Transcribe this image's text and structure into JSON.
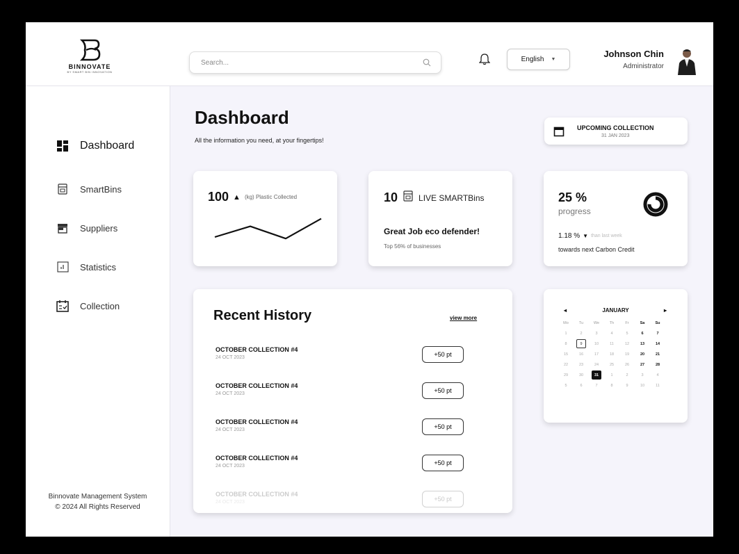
{
  "brand": {
    "name": "BINNOVATE",
    "tagline": "BY SMART BIN INNOVATION"
  },
  "search": {
    "placeholder": "Search..."
  },
  "language": {
    "selected": "English"
  },
  "user": {
    "name": "Johnson Chin",
    "role": "Administrator"
  },
  "sidebar": {
    "items": [
      {
        "label": "Dashboard",
        "icon": "dashboard-icon",
        "active": true
      },
      {
        "label": "SmartBins",
        "icon": "smartbin-icon",
        "active": false
      },
      {
        "label": "Suppliers",
        "icon": "store-icon",
        "active": false
      },
      {
        "label": "Statistics",
        "icon": "chart-icon",
        "active": false
      },
      {
        "label": "Collection",
        "icon": "calendar-check-icon",
        "active": false
      }
    ],
    "footer_line1": "Binnovate Management System",
    "footer_line2": "© 2024 All Rights Reserved"
  },
  "main": {
    "title": "Dashboard",
    "subtitle": "All the information you need, at your fingertips!"
  },
  "upcoming": {
    "label": "UPCOMING COLLECTION",
    "date": "31 JAN 2023"
  },
  "plastic": {
    "value": "100",
    "unit": "(kg) Plastic Collected",
    "trend_points": [
      0.25,
      0.6,
      0.2,
      0.85
    ]
  },
  "bins": {
    "value": "10",
    "label": "LIVE SMARTBins",
    "headline": "Great Job eco defender!",
    "note": "Top 56% of businesses"
  },
  "progress": {
    "value": "25 %",
    "label": "progress",
    "fraction": 0.25,
    "change": "1.18 %",
    "change_note": "than last week",
    "footer": "towards next Carbon Credit"
  },
  "history": {
    "title": "Recent History",
    "view_more": "view more",
    "rows": [
      {
        "title": "OCTOBER COLLECTION #4",
        "date": "24 OCT 2023",
        "points": "+50 pt"
      },
      {
        "title": "OCTOBER COLLECTION #4",
        "date": "24 OCT 2023",
        "points": "+50 pt"
      },
      {
        "title": "OCTOBER COLLECTION #4",
        "date": "24 OCT 2023",
        "points": "+50 pt"
      },
      {
        "title": "OCTOBER COLLECTION #4",
        "date": "24 OCT 2023",
        "points": "+50 pt"
      },
      {
        "title": "OCTOBER COLLECTION #4",
        "date": "24 OCT 2023",
        "points": "+50 pt"
      }
    ]
  },
  "calendar": {
    "month": "JANUARY",
    "prev": "◂",
    "next": "▸",
    "weekdays": [
      "Mo",
      "Tu",
      "We",
      "Th",
      "Fr",
      "Sa",
      "Su"
    ],
    "weeks": [
      [
        "1",
        "2",
        "3",
        "4",
        "5",
        "6",
        "7"
      ],
      [
        "8",
        "9",
        "10",
        "11",
        "12",
        "13",
        "14"
      ],
      [
        "15",
        "16",
        "17",
        "18",
        "19",
        "20",
        "21"
      ],
      [
        "22",
        "23",
        "24",
        "25",
        "26",
        "27",
        "28"
      ],
      [
        "29",
        "30",
        "31",
        "1",
        "2",
        "3",
        "4"
      ],
      [
        "5",
        "6",
        "7",
        "8",
        "9",
        "10",
        "11"
      ]
    ],
    "today": "9",
    "selected": "31"
  },
  "colors": {
    "background": "#f5f4fb",
    "accent": "#111111",
    "card": "#ffffff"
  }
}
